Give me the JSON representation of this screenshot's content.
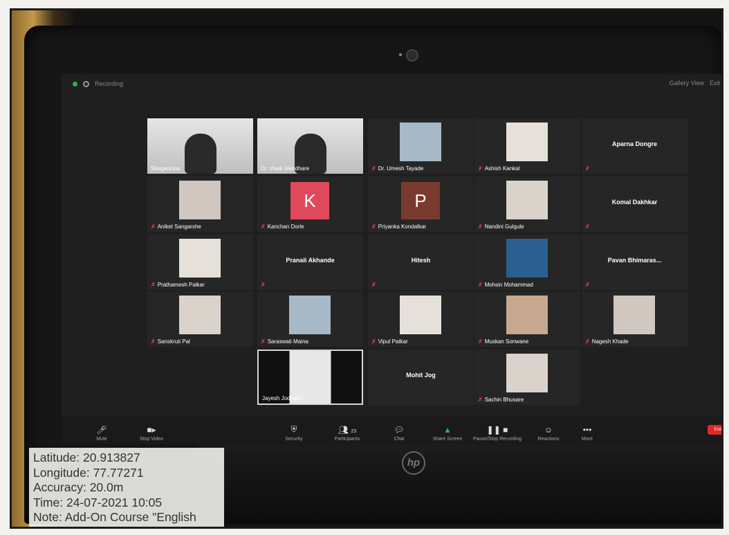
{
  "screen": {
    "topbar": {
      "recording_label": "Recording",
      "view_label": "Gallery View",
      "exit_label": "Exit"
    },
    "tiles": [
      {
        "name": "Shegaonkar",
        "kind": "video"
      },
      {
        "name": "Dr. Vivek Mendhare",
        "kind": "video"
      },
      {
        "name": "Dr. Umesh Tayade",
        "kind": "photo",
        "muted": true
      },
      {
        "name": "Ashish Kankal",
        "kind": "photo",
        "muted": true
      },
      {
        "name": "Aparna Dongre",
        "kind": "name",
        "muted": true
      },
      {
        "name": "Aniket Sangarshe",
        "kind": "photo",
        "muted": true
      },
      {
        "name": "Kanchan Dorle",
        "kind": "letter",
        "letter": "K",
        "color": "#e0495c",
        "muted": true
      },
      {
        "name": "Priyanka Kondalkar",
        "kind": "letter",
        "letter": "P",
        "color": "#7a3b2e",
        "muted": true
      },
      {
        "name": "Nandini Gulgule",
        "kind": "photo",
        "muted": true
      },
      {
        "name": "Komal Dakhkar",
        "kind": "name",
        "muted": true
      },
      {
        "name": "Prathamesh Palkar",
        "kind": "photo",
        "muted": true
      },
      {
        "name": "Pranali Akhande",
        "kind": "name",
        "muted": true
      },
      {
        "name": "Hitesh",
        "kind": "name",
        "muted": true
      },
      {
        "name": "Mohsin Mohammad",
        "kind": "photo",
        "muted": true
      },
      {
        "name": "Pavan Bhimaras...",
        "kind": "name",
        "muted": true
      },
      {
        "name": "Sanskruti Pal",
        "kind": "photo",
        "muted": true
      },
      {
        "name": "Saraswati Maina",
        "kind": "photo",
        "muted": true
      },
      {
        "name": "Vipul Patkar",
        "kind": "photo",
        "muted": true
      },
      {
        "name": "Muskan Sonwane",
        "kind": "photo",
        "muted": true
      },
      {
        "name": "Nagesh Khade",
        "kind": "photo",
        "muted": true
      },
      {
        "name": "Jayesh Jodhale",
        "kind": "video",
        "active": true
      },
      {
        "name": "Mohit Jog",
        "kind": "name",
        "muted": false
      },
      {
        "name": "Sachin Bhusare",
        "kind": "photo",
        "muted": true
      }
    ],
    "toolbar": {
      "mute": "Mute",
      "stop_video": "Stop Video",
      "security": "Security",
      "participants": "Participants",
      "participants_count": "23",
      "chat": "Chat",
      "share_screen": "Share Screen",
      "pause_recording": "Pause/Stop Recording",
      "reactions": "Reactions",
      "more": "More",
      "end": "End"
    }
  },
  "gps_overlay": {
    "latitude": "Latitude: 20.913827",
    "longitude": "Longitude: 77.77271",
    "accuracy": "Accuracy: 20.0m",
    "time": "Time: 24-07-2021 10:05",
    "note": "Note: Add-On Course \"English"
  },
  "brand": {
    "logo_text": "hp"
  },
  "colors": {
    "mute_icon": "#e53935",
    "toolbar_green": "#25b84a",
    "end_button": "#e02828"
  }
}
